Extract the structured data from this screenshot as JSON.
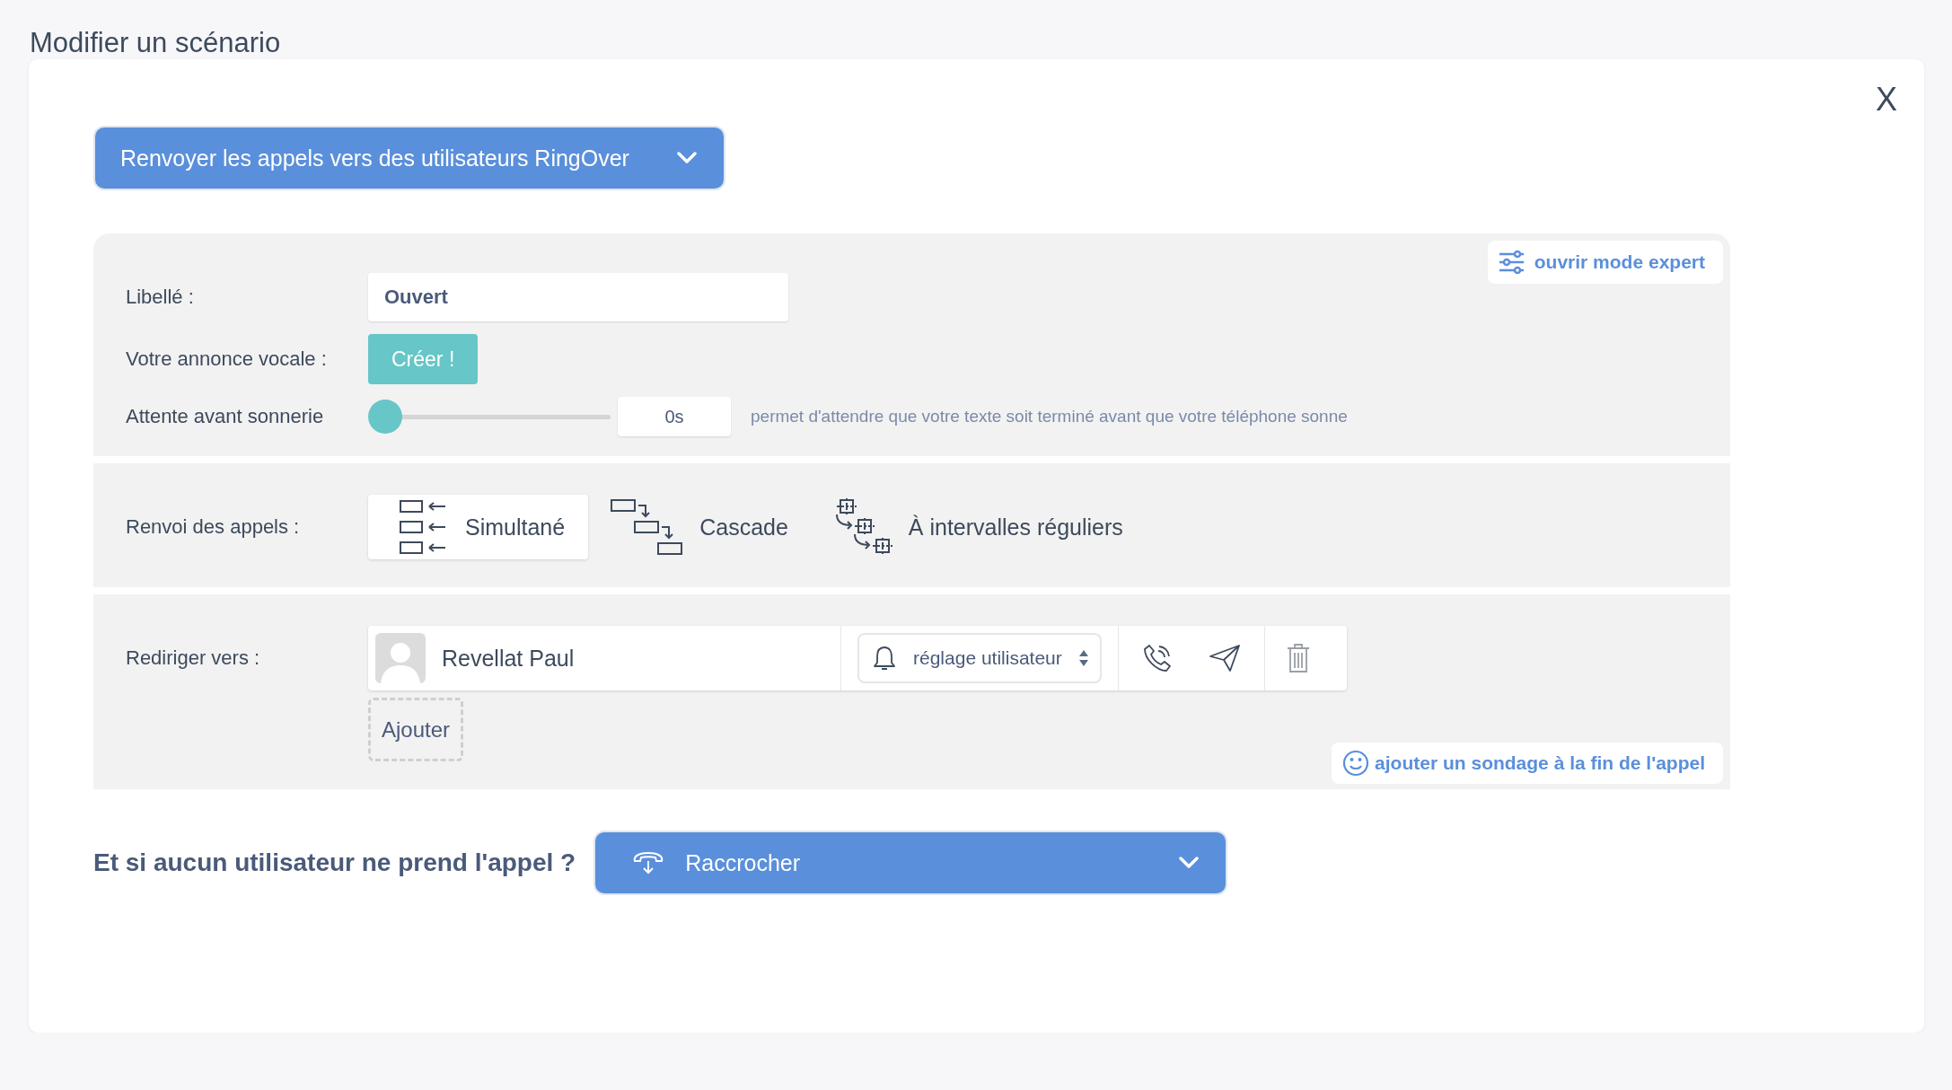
{
  "page_title": "Modifier un scénario",
  "close_label": "X",
  "action_select": {
    "value": "Renvoyer les appels vers des utilisateurs RingOver"
  },
  "expert_button": "ouvrir mode expert",
  "label_field": {
    "label": "Libellé :",
    "value": "Ouvert"
  },
  "voice_announcement": {
    "label": "Votre annonce vocale :",
    "button": "Créer !"
  },
  "ring_delay": {
    "label": "Attente avant sonnerie",
    "level": 0,
    "reading": "0s",
    "hint": "permet d'attendre que votre texte soit terminé avant que votre téléphone sonne"
  },
  "forwarding": {
    "label": "Renvoi des appels :",
    "modes": [
      {
        "kind": "simultaneous",
        "label": "Simultané",
        "selected": true
      },
      {
        "kind": "cascade",
        "label": "Cascade",
        "selected": false
      },
      {
        "kind": "interval",
        "label": "À intervalles réguliers",
        "selected": false
      }
    ]
  },
  "redirect": {
    "label": "Rediriger vers :",
    "targets": [
      {
        "name": "Revellat Paul",
        "ring_setting": "réglage utilisateur"
      }
    ],
    "add_button": "Ajouter",
    "survey_button": "ajouter un sondage à la fin de l'appel"
  },
  "fallback": {
    "question": "Et si aucun utilisateur ne prend l'appel ?",
    "value": "Raccrocher"
  }
}
